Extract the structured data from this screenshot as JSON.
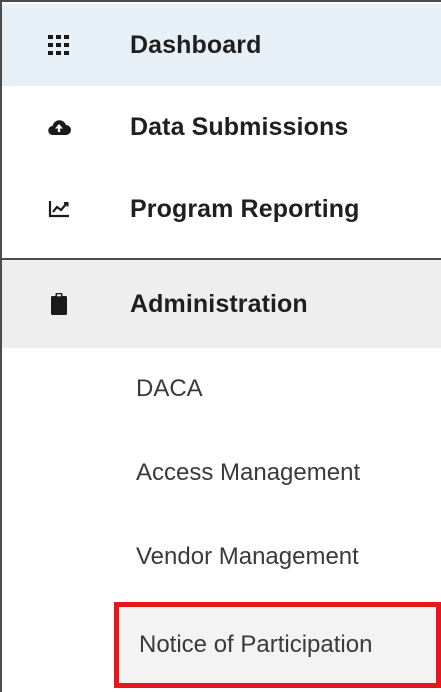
{
  "sidebar": {
    "items": [
      {
        "label": "Dashboard",
        "icon": "grid-icon"
      },
      {
        "label": "Data Submissions",
        "icon": "cloud-upload-icon"
      },
      {
        "label": "Program Reporting",
        "icon": "line-chart-icon"
      },
      {
        "label": "Administration",
        "icon": "clipboard-icon",
        "expanded": true
      }
    ],
    "admin_subitems": [
      {
        "label": "DACA"
      },
      {
        "label": "Access Management"
      },
      {
        "label": "Vendor Management"
      },
      {
        "label": "Notice of Participation",
        "highlighted": true
      }
    ],
    "colors": {
      "dashboard_bg": "#e7f0f6",
      "admin_bg": "#eeeeee",
      "highlight_border": "#e8161b",
      "text_dark": "#1f1f1f",
      "text_sub": "#3a3a3a"
    }
  }
}
